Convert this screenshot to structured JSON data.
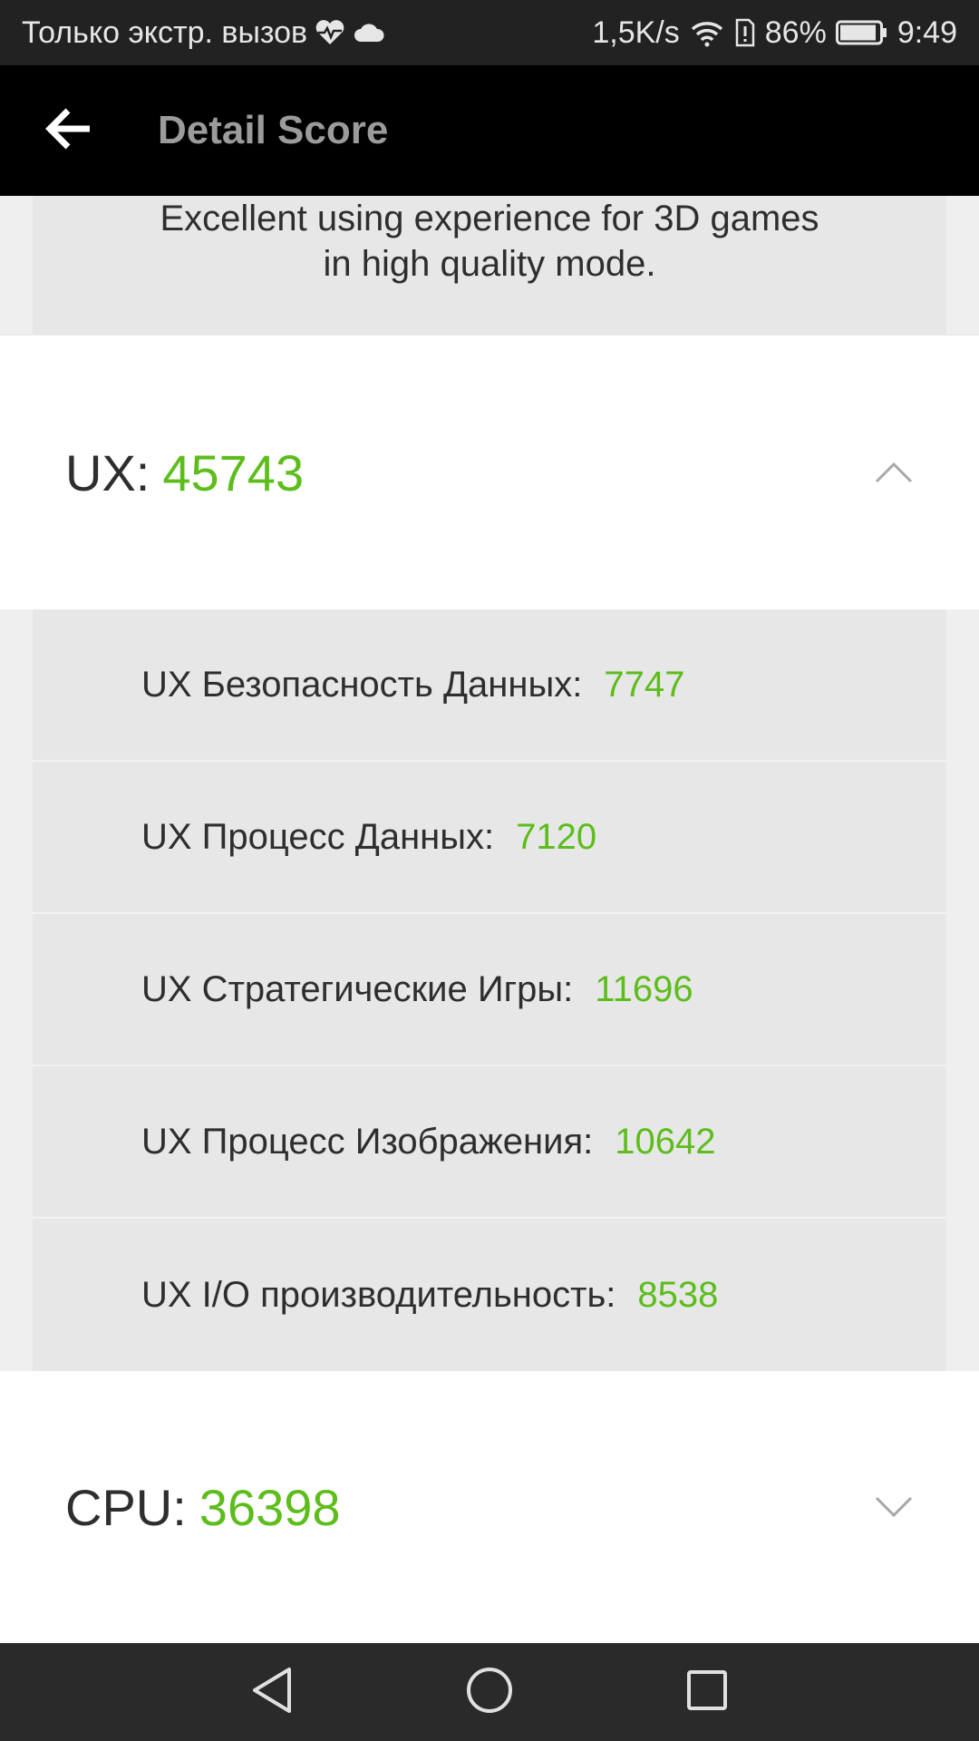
{
  "status_bar": {
    "carrier_text": "Только экстр. вызов",
    "network_speed": "1,5K/s",
    "battery_percent": "86%",
    "time": "9:49"
  },
  "app_bar": {
    "title": "Detail Score"
  },
  "description": {
    "line1": "Excellent using experience for 3D games",
    "line2": "in high quality mode."
  },
  "ux": {
    "label": "UX:",
    "value": "45743",
    "expanded": true,
    "items": [
      {
        "label": "UX Безопасность Данных:",
        "value": "7747"
      },
      {
        "label": "UX Процесс Данных:",
        "value": "7120"
      },
      {
        "label": "UX Стратегические Игры:",
        "value": "11696"
      },
      {
        "label": "UX Процесс Изображения:",
        "value": "10642"
      },
      {
        "label": "UX I/O производительность:",
        "value": "8538"
      }
    ]
  },
  "cpu": {
    "label": "CPU:",
    "value": "36398",
    "expanded": false
  },
  "colors": {
    "score_green": "#5cbd1b",
    "app_bar_bg": "#000000",
    "status_bar_bg": "#222222",
    "nav_bar_bg": "#2a2a2a"
  },
  "icons": {
    "back": "arrow-left-icon",
    "collapse": "chevron-up-icon",
    "expand": "chevron-down-icon",
    "nav_back": "triangle-back-icon",
    "nav_home": "circle-home-icon",
    "nav_recents": "square-recents-icon"
  }
}
